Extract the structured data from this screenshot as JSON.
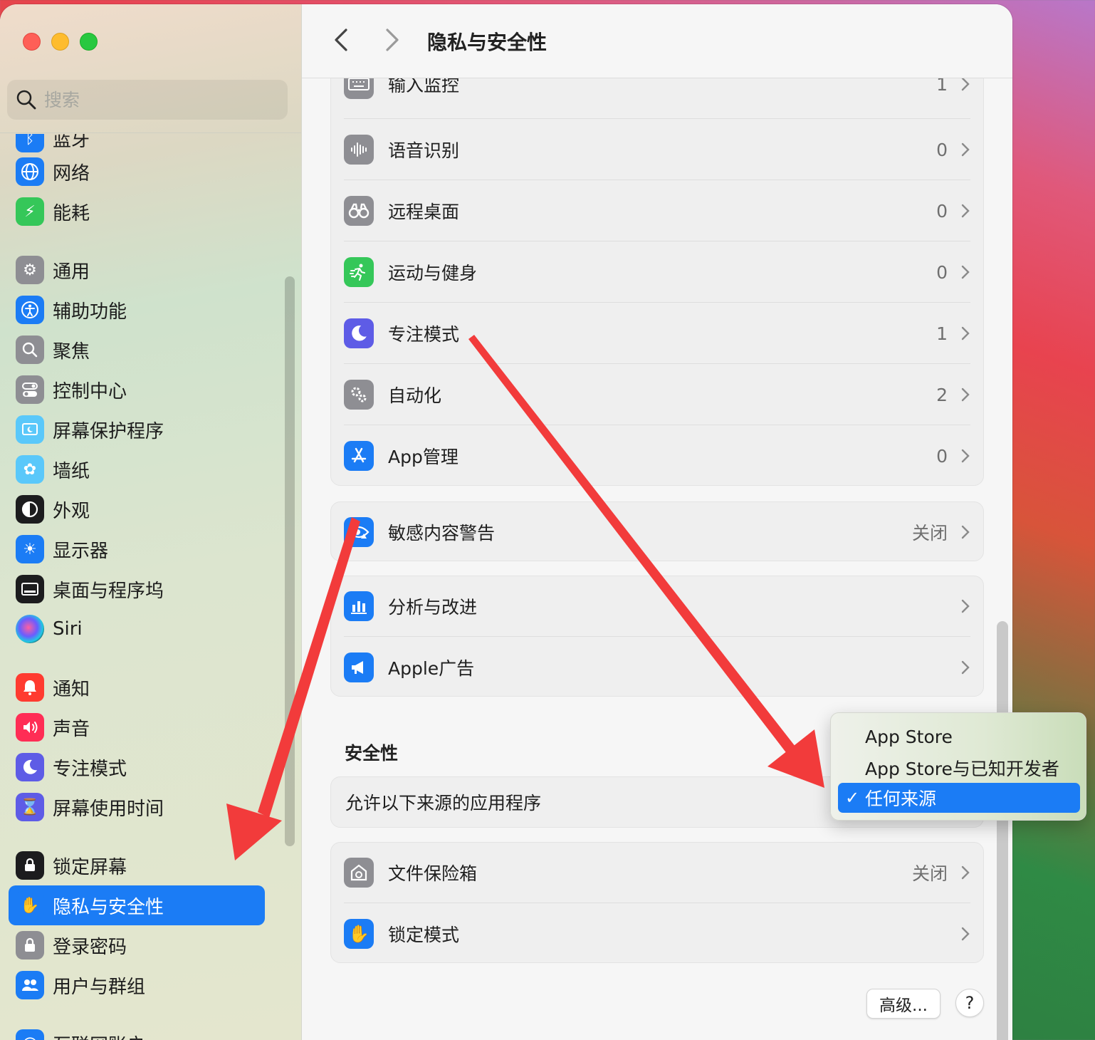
{
  "window": {
    "title": "隐私与安全性"
  },
  "search": {
    "placeholder": "搜索"
  },
  "sidebar": {
    "items": [
      {
        "label": "蓝牙",
        "icon": "bluetooth-icon",
        "color": "#1b7cf5"
      },
      {
        "label": "网络",
        "icon": "globe-icon",
        "color": "#1b7cf5"
      },
      {
        "label": "能耗",
        "icon": "bolt-icon",
        "color": "#35c759"
      },
      {
        "label": "通用",
        "icon": "gear-icon",
        "color": "#8e8e93"
      },
      {
        "label": "辅助功能",
        "icon": "accessibility-icon",
        "color": "#1b7cf5"
      },
      {
        "label": "聚焦",
        "icon": "magnifier-icon",
        "color": "#8e8e93"
      },
      {
        "label": "控制中心",
        "icon": "toggles-icon",
        "color": "#8e8e93"
      },
      {
        "label": "屏幕保护程序",
        "icon": "screensaver-icon",
        "color": "#5ac8fa"
      },
      {
        "label": "墙纸",
        "icon": "flower-icon",
        "color": "#5ac8fa"
      },
      {
        "label": "外观",
        "icon": "appearance-icon",
        "color": "#1c1c1e"
      },
      {
        "label": "显示器",
        "icon": "sun-icon",
        "color": "#1b7cf5"
      },
      {
        "label": "桌面与程序坞",
        "icon": "dock-icon",
        "color": "#1c1c1e"
      },
      {
        "label": "Siri",
        "icon": "siri-icon",
        "color": "#2c2c3a"
      },
      {
        "label": "通知",
        "icon": "bell-icon",
        "color": "#ff3b30"
      },
      {
        "label": "声音",
        "icon": "speaker-icon",
        "color": "#ff2d55"
      },
      {
        "label": "专注模式",
        "icon": "moon-icon",
        "color": "#5e5ce6"
      },
      {
        "label": "屏幕使用时间",
        "icon": "hourglass-icon",
        "color": "#5e5ce6"
      },
      {
        "label": "锁定屏幕",
        "icon": "lock-screen-icon",
        "color": "#1c1c1e"
      },
      {
        "label": "隐私与安全性",
        "icon": "hand-icon",
        "color": "#1b7cf5",
        "active": true
      },
      {
        "label": "登录密码",
        "icon": "padlock-icon",
        "color": "#8e8e93"
      },
      {
        "label": "用户与群组",
        "icon": "users-icon",
        "color": "#1b7cf5"
      },
      {
        "label": "互联网账户",
        "icon": "at-icon",
        "color": "#1b7cf5"
      }
    ]
  },
  "privacy": {
    "rows": [
      {
        "label": "输入监控",
        "value": "1",
        "icon": "keyboard-icon",
        "color": "#8e8e93"
      },
      {
        "label": "语音识别",
        "value": "0",
        "icon": "waveform-icon",
        "color": "#8e8e93"
      },
      {
        "label": "远程桌面",
        "value": "0",
        "icon": "binoculars-icon",
        "color": "#8e8e93"
      },
      {
        "label": "运动与健身",
        "value": "0",
        "icon": "running-icon",
        "color": "#35c759"
      },
      {
        "label": "专注模式",
        "value": "1",
        "icon": "moon-icon",
        "color": "#5e5ce6"
      },
      {
        "label": "自动化",
        "value": "2",
        "icon": "gears-icon",
        "color": "#8e8e93"
      },
      {
        "label": "App管理",
        "value": "0",
        "icon": "appstore-icon",
        "color": "#1b7cf5"
      }
    ],
    "sensitive": {
      "label": "敏感内容警告",
      "value": "关闭",
      "icon": "eye-warning-icon",
      "color": "#1b7cf5"
    },
    "analytics": [
      {
        "label": "分析与改进",
        "value": "",
        "icon": "chart-icon",
        "color": "#1b7cf5"
      },
      {
        "label": "Apple广告",
        "value": "",
        "icon": "megaphone-icon",
        "color": "#1b7cf5"
      }
    ]
  },
  "security": {
    "section_title": "安全性",
    "allow_label": "允许以下来源的应用程序",
    "dropdown": {
      "options": [
        "App Store",
        "App Store与已知开发者",
        "任何来源"
      ],
      "selected": "任何来源",
      "check": "✓"
    },
    "rows": [
      {
        "label": "文件保险箱",
        "value": "关闭",
        "icon": "vault-icon",
        "color": "#8e8e93"
      },
      {
        "label": "锁定模式",
        "value": "",
        "icon": "hand-icon",
        "color": "#1b7cf5"
      }
    ]
  },
  "footer": {
    "advanced_label": "高级...",
    "help_label": "?"
  },
  "annotation_color": "#f23b3b"
}
